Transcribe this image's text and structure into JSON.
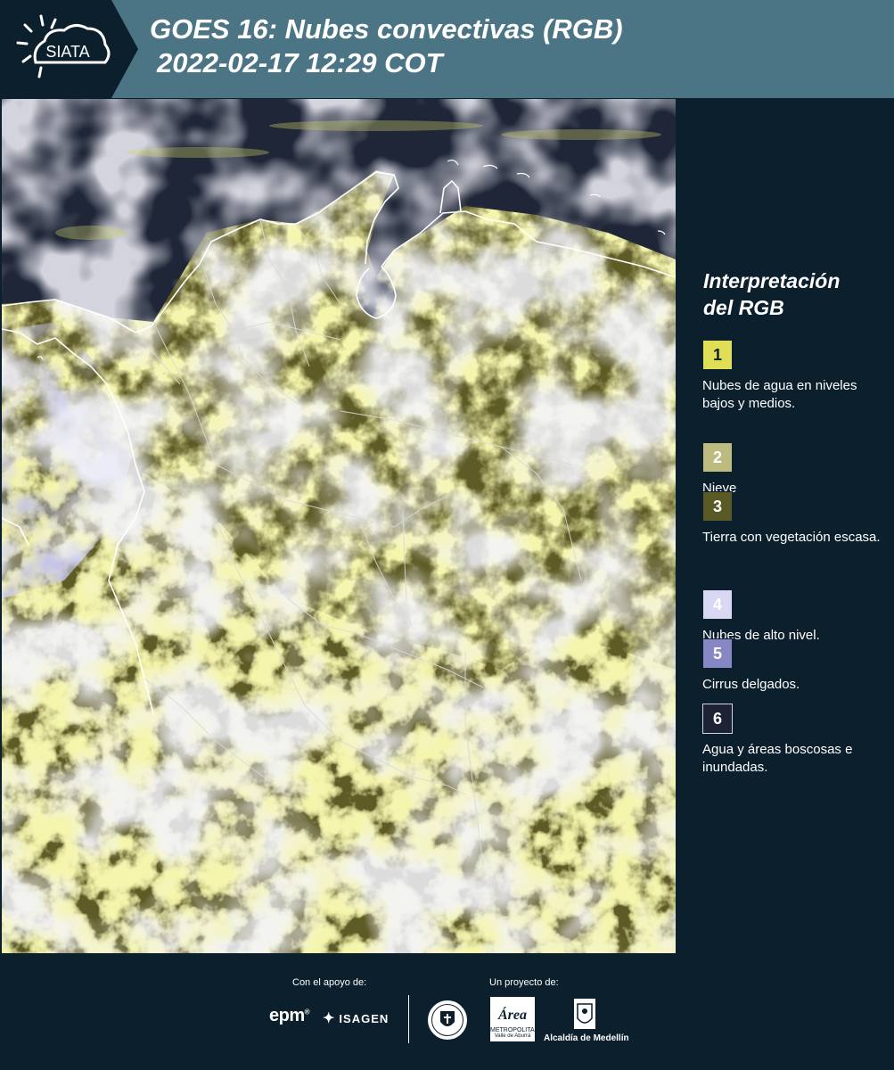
{
  "header": {
    "logo_text": "SIATA",
    "title_line1": "GOES 16: Nubes convectivas (RGB)",
    "title_line2": "2022-02-17 12:29 COT",
    "color": "#4b7585",
    "tab_color": "#0c1f2c"
  },
  "legend": {
    "title_line1": "Interpretación",
    "title_line2": "del RGB",
    "items": [
      {
        "number": "1",
        "label": "Nubes de agua en niveles bajos y medios.",
        "color": "#e0de55",
        "text_color": "#0c1f2c"
      },
      {
        "number": "2",
        "label": "Nieve",
        "color": "#bdbb80",
        "text_color": "#ffffff"
      },
      {
        "number": "3",
        "label": "Tierra con vegetación escasa.",
        "color": "#5a5a26",
        "text_color": "#ffffff"
      },
      {
        "number": "4",
        "label": "Nubes de alto nivel.",
        "color": "#d8d8f4",
        "text_color": "#ffffff"
      },
      {
        "number": "5",
        "label": "Cirrus delgados.",
        "color": "#8787c6",
        "text_color": "#ffffff"
      },
      {
        "number": "6",
        "label": "Agua y áreas boscosas e inundadas.",
        "color": "#1e2235",
        "text_color": "#ffffff"
      }
    ]
  },
  "footer": {
    "support_label": "Con el apoyo de:",
    "project_label": "Un proyecto de:",
    "epm": "epm",
    "isagen": "ISAGEN",
    "area_script": "Área",
    "area_line1": "METROPOLITANA",
    "area_line2": "Valle de Aburrá",
    "alcaldia": "Alcaldía de Medellín"
  },
  "map": {
    "cloud_yellow": "#e8e86a",
    "cloud_white": "#e6e6f2",
    "cirrus": "#8a8ad0",
    "water": "#1f2637",
    "land": "#5e5b26"
  }
}
